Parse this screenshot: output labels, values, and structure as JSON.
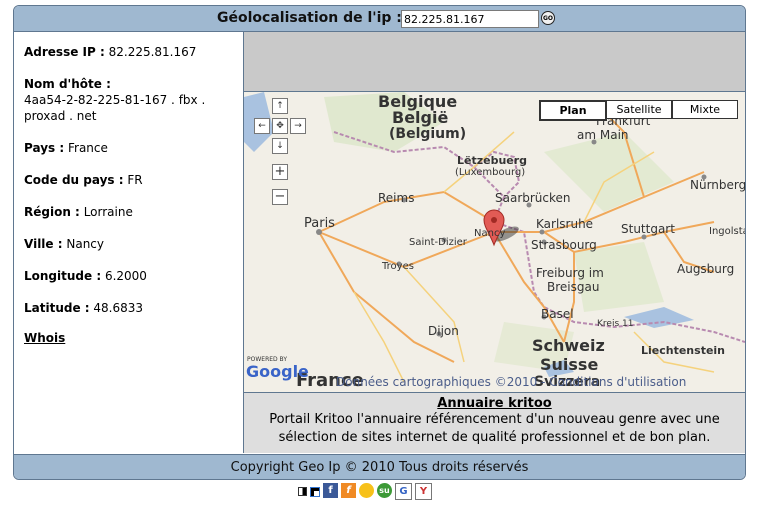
{
  "header": {
    "label": "Géolocalisation de l'ip :",
    "ip_value": "82.225.81.167",
    "go_label": "GO"
  },
  "info": {
    "ip_label": "Adresse IP :",
    "ip_value": "82.225.81.167",
    "host_label": "Nom d'hôte :",
    "host_value": "4aa54-2-82-225-81-167 . fbx . proxad . net",
    "country_label": "Pays :",
    "country_value": "France",
    "country_code_label": "Code du pays :",
    "country_code_value": "FR",
    "region_label": "Région :",
    "region_value": "Lorraine",
    "city_label": "Ville :",
    "city_value": "Nancy",
    "longitude_label": "Longitude :",
    "longitude_value": "6.2000",
    "latitude_label": "Latitude :",
    "latitude_value": "48.6833",
    "whois": "Whois"
  },
  "map": {
    "types": [
      "Plan",
      "Satellite",
      "Mixte"
    ],
    "labels": {
      "belgique": "Belgique",
      "belgie": "België",
      "belgium": "(Belgium)",
      "luxembourg": "Lëtzebuerg",
      "luxembourg2": "(Luxembourg)",
      "frankfurt": "Frankfurt",
      "am_main": "am Main",
      "nurnberg": "Nürnberg",
      "saarbrucken": "Saarbrücken",
      "reims": "Reims",
      "paris": "Paris",
      "saint_dizier": "Saint-Dizier",
      "karlsruhe": "Karlsruhe",
      "stuttgart": "Stuttgart",
      "strasbourg": "Strasbourg",
      "troyes": "Troyes",
      "freiburg": "Freiburg im",
      "breisgau": "Breisgau",
      "augsburg": "Augsburg",
      "dijon": "Dijon",
      "basel": "Basel",
      "kreis": "Kreis 11",
      "schweiz": "Schweiz",
      "suisse": "Suisse",
      "svizzera": "Svizzera",
      "liechtenstein": "Liechtenstein",
      "france": "France",
      "nancy": "Nancy",
      "powered": "POWERED BY",
      "google": "Google",
      "copyright": "Données cartographiques ©2010 - Conditions d'utilisation"
    }
  },
  "ad": {
    "title": "Annuaire kritoo",
    "text": "Portail Kritoo l'annuaire référencement d'un nouveau genre avec une sélection de sites internet de qualité professionnel et de bon plan."
  },
  "footer": {
    "text": "Copyright Geo Ip © 2010 Tous droits réservés"
  },
  "share_icons": [
    "delicious-icon",
    "facebook-icon",
    "friendfeed-icon",
    "yahoo-buzz-icon",
    "stumbleupon-icon",
    "google-bookmark-icon",
    "yahoo-icon"
  ]
}
